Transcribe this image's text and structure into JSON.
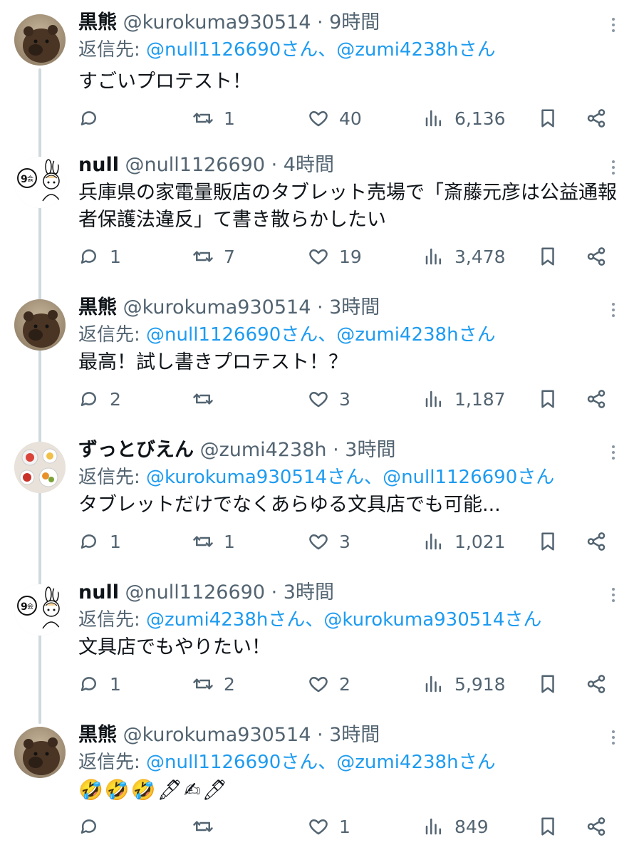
{
  "colors": {
    "link": "#1d9bf0",
    "secondary": "#536471",
    "primary": "#0f1419",
    "thread": "#cfd9de"
  },
  "tweets": [
    {
      "name": "黒熊",
      "handle": "@kurokuma930514",
      "sep": " · ",
      "time": "9時間",
      "reply_prefix": "返信先: ",
      "mention1": "@null1126690さん",
      "joiner": "、",
      "mention2": "@zumi4238hさん",
      "text": "すごいプロテスト！",
      "avatar": "bear-avatar",
      "reply_count": "",
      "retweet_count": "1",
      "like_count": "40",
      "view_count": "6,136"
    },
    {
      "name": "null",
      "handle": "@null1126690",
      "sep": " · ",
      "time": "4時間",
      "reply_prefix": "",
      "mention1": "",
      "joiner": "",
      "mention2": "",
      "text": "兵庫県の家電量販店のタブレット売場で「斎藤元彦は公益通報者保護法違反」て書き散らかしたい",
      "avatar": "drawing-avatar",
      "reply_count": "1",
      "retweet_count": "7",
      "like_count": "19",
      "view_count": "3,478"
    },
    {
      "name": "黒熊",
      "handle": "@kurokuma930514",
      "sep": " · ",
      "time": "3時間",
      "reply_prefix": "返信先: ",
      "mention1": "@null1126690さん",
      "joiner": "、",
      "mention2": "@zumi4238hさん",
      "text": "最高！試し書きプロテスト！？",
      "avatar": "bear-avatar",
      "reply_count": "2",
      "retweet_count": "",
      "like_count": "3",
      "view_count": "1,187"
    },
    {
      "name": "ずっとびえん",
      "handle": "@zumi4238h",
      "sep": " · ",
      "time": "3時間",
      "reply_prefix": "返信先: ",
      "mention1": "@kurokuma930514さん",
      "joiner": "、",
      "mention2": "@null1126690さん",
      "text": "タブレットだけでなくあらゆる文具店でも可能...",
      "avatar": "food-avatar",
      "reply_count": "1",
      "retweet_count": "1",
      "like_count": "3",
      "view_count": "1,021"
    },
    {
      "name": "null",
      "handle": "@null1126690",
      "sep": " · ",
      "time": "3時間",
      "reply_prefix": "返信先: ",
      "mention1": "@zumi4238hさん",
      "joiner": "、",
      "mention2": "@kurokuma930514さん",
      "text": "文具店でもやりたい！",
      "avatar": "drawing-avatar",
      "reply_count": "1",
      "retweet_count": "2",
      "like_count": "2",
      "view_count": "5,918"
    },
    {
      "name": "黒熊",
      "handle": "@kurokuma930514",
      "sep": " · ",
      "time": "3時間",
      "reply_prefix": "返信先: ",
      "mention1": "@null1126690さん",
      "joiner": "、",
      "mention2": "@zumi4238hさん",
      "text": "🤣🤣🤣🖋✍🖊",
      "avatar": "bear-avatar",
      "reply_count": "",
      "retweet_count": "",
      "like_count": "1",
      "view_count": "849"
    }
  ]
}
